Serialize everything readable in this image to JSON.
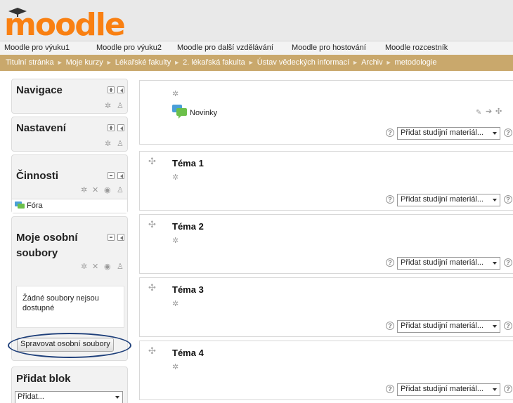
{
  "header": {
    "logo": "moodle"
  },
  "topnav": [
    "Moodle pro výuku1",
    "Moodle pro výuku2",
    "Moodle pro další vzdělávání",
    "Moodle pro hostování",
    "Moodle rozcestník"
  ],
  "breadcrumb": [
    "Titulní stránka",
    "Moje kurzy",
    "Lékařské fakulty",
    "2. lékařská fakulta",
    "Ústav vědeckých informací",
    "Archiv",
    "metodologie"
  ],
  "blocks": {
    "navigace": {
      "title": "Navigace"
    },
    "nastaveni": {
      "title": "Nastavení"
    },
    "cinnosti": {
      "title": "Činnosti",
      "item": "Fóra"
    },
    "soubory": {
      "title_line1": "Moje osobní",
      "title_line2": "soubory",
      "empty": "Žádné soubory nejsou dostupné",
      "button": "Spravovat osobní soubory"
    },
    "pridat": {
      "title": "Přidat blok",
      "select": "Přidat..."
    }
  },
  "main": {
    "news": "Novinky",
    "add_label": "Přidat studijní materiál...",
    "topics": [
      "Téma 1",
      "Téma 2",
      "Téma 3",
      "Téma 4"
    ]
  },
  "colors": {
    "brand_orange": "#f98012",
    "breadcrumb_bg": "#c9a86c",
    "highlight": "#1e3f7a"
  }
}
